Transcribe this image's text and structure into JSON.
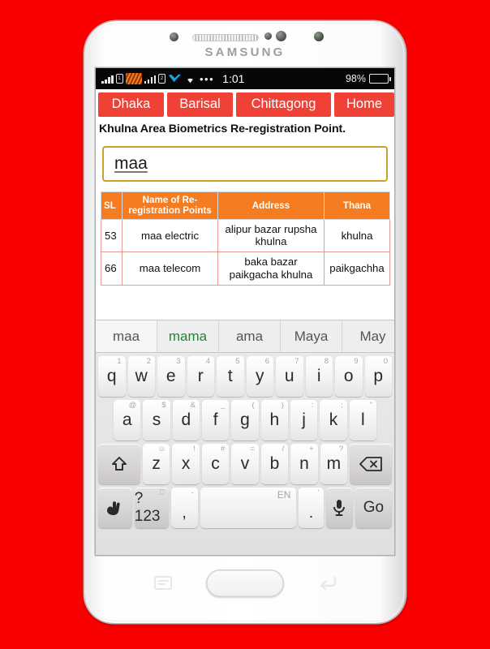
{
  "device": {
    "brand": "SAMSUNG",
    "body_color": "#ffffff",
    "wallpaper_color": "#fb0000",
    "hardware": {
      "speaker_name": "earpiece-speaker",
      "home_button": "home-button",
      "menu_key": "menu-key",
      "back_key": "back-key"
    }
  },
  "status_bar": {
    "clock": "1:01",
    "battery_percent": "98%",
    "battery_level": 98,
    "icons": [
      "signal-bars-icon",
      "sim1-icon",
      "sim-stripe-icon",
      "signal-bars-icon",
      "sim2-icon",
      "carrier-logo-icon",
      "wifi-icon"
    ],
    "overflow": "•••",
    "background": "#070707"
  },
  "nav": {
    "accent": "#ef4136",
    "buttons": [
      {
        "label": "Dhaka",
        "name": "nav-button-dhaka"
      },
      {
        "label": "Barisal",
        "name": "nav-button-barisal"
      },
      {
        "label": "Chittagong",
        "name": "nav-button-chittagong"
      },
      {
        "label": "Home",
        "name": "nav-button-home"
      }
    ]
  },
  "page": {
    "title": "Khulna Area Biometrics Re-registration Point."
  },
  "search": {
    "value": "maa",
    "placeholder": "",
    "border_color": "#c8a22d"
  },
  "table": {
    "header_color": "#f57c20",
    "columns": [
      "SL",
      "Name of Re-registration Points",
      "Address",
      "Thana"
    ],
    "rows": [
      {
        "sl": "53",
        "name": "maa electric",
        "address": "alipur bazar rupsha khulna",
        "thana": "khulna"
      },
      {
        "sl": "66",
        "name": "maa telecom",
        "address": "baka bazar paikgacha khulna",
        "thana": "paikgachha"
      }
    ]
  },
  "keyboard": {
    "suggestions": [
      {
        "text": "maa",
        "state": "active"
      },
      {
        "text": "mama",
        "state": "bold-green"
      },
      {
        "text": "ama",
        "state": "normal"
      },
      {
        "text": "Maya",
        "state": "normal"
      },
      {
        "text": "May",
        "state": "normal"
      }
    ],
    "row1": [
      {
        "key": "q",
        "hint": "1"
      },
      {
        "key": "w",
        "hint": "2"
      },
      {
        "key": "e",
        "hint": "3"
      },
      {
        "key": "r",
        "hint": "4"
      },
      {
        "key": "t",
        "hint": "5"
      },
      {
        "key": "y",
        "hint": "6"
      },
      {
        "key": "u",
        "hint": "7"
      },
      {
        "key": "i",
        "hint": "8"
      },
      {
        "key": "o",
        "hint": "9"
      },
      {
        "key": "p",
        "hint": "0"
      }
    ],
    "row2": [
      {
        "key": "a",
        "hint": "@"
      },
      {
        "key": "s",
        "hint": "$"
      },
      {
        "key": "d",
        "hint": "&"
      },
      {
        "key": "f",
        "hint": "_"
      },
      {
        "key": "g",
        "hint": "("
      },
      {
        "key": "h",
        "hint": ")"
      },
      {
        "key": "j",
        "hint": ":"
      },
      {
        "key": "k",
        "hint": ";"
      },
      {
        "key": "l",
        "hint": "\""
      }
    ],
    "row3": [
      {
        "key": "z",
        "hint": "☺"
      },
      {
        "key": "x",
        "hint": "!"
      },
      {
        "key": "c",
        "hint": "#"
      },
      {
        "key": "v",
        "hint": "="
      },
      {
        "key": "b",
        "hint": "/"
      },
      {
        "key": "n",
        "hint": "+"
      },
      {
        "key": "m",
        "hint": "?"
      }
    ],
    "shift_label": "⇧",
    "backspace_label": "⌫",
    "gesture_label": "✋",
    "symbols_label": "?123",
    "symbols_hint": "⎕",
    "comma_label": ",",
    "comma_hint": "-",
    "space_label": "",
    "space_hint": "EN",
    "period_label": ".",
    "period_hint": "'",
    "mic_label": "🎤",
    "go_label": "Go"
  }
}
